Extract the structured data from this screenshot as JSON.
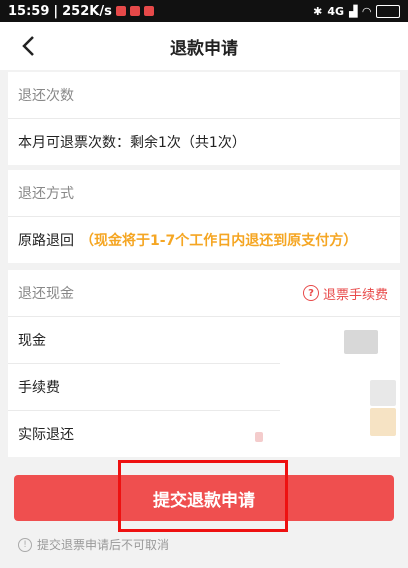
{
  "status": {
    "time": "15:59",
    "speed": "252K/s",
    "signal": "4G",
    "battery": "85"
  },
  "nav": {
    "title": "退款申请"
  },
  "count_section": {
    "header": "退还次数",
    "text": "本月可退票次数：剩余1次（共1次）"
  },
  "method_section": {
    "header": "退还方式",
    "method": "原路退回",
    "hint": "（现金将于1-7个工作日内退还到原支付方）"
  },
  "cash_section": {
    "header": "退还现金",
    "fee_link": "退票手续费",
    "rows": [
      {
        "label": "现金"
      },
      {
        "label": "手续费"
      },
      {
        "label": "实际退还"
      }
    ]
  },
  "submit": {
    "label": "提交退款申请"
  },
  "notice": {
    "text": "提交退票申请后不可取消"
  },
  "colors": {
    "brand_red": "#ef4f4f",
    "orange": "#f5a623",
    "link_red": "#e84a4a"
  }
}
